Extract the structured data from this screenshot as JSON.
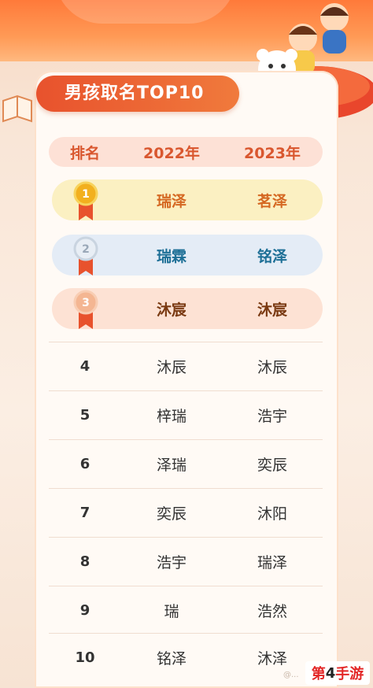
{
  "title": "男孩取名TOP10",
  "header": {
    "rank": "排名",
    "year_a": "2022年",
    "year_b": "2023年"
  },
  "medal_numbers": [
    "1",
    "2",
    "3"
  ],
  "rows": [
    {
      "rank": "1",
      "a": "瑞泽",
      "b": "茗泽"
    },
    {
      "rank": "2",
      "a": "瑞霖",
      "b": "铭泽"
    },
    {
      "rank": "3",
      "a": "沐宸",
      "b": "沐宸"
    },
    {
      "rank": "4",
      "a": "沐辰",
      "b": "沐辰"
    },
    {
      "rank": "5",
      "a": "梓瑞",
      "b": "浩宇"
    },
    {
      "rank": "6",
      "a": "泽瑞",
      "b": "奕辰"
    },
    {
      "rank": "7",
      "a": "奕辰",
      "b": "沐阳"
    },
    {
      "rank": "8",
      "a": "浩宇",
      "b": "瑞泽"
    },
    {
      "rank": "9",
      "a": "瑞",
      "b": "浩然"
    },
    {
      "rank": "10",
      "a": "铭泽",
      "b": "沐泽"
    }
  ],
  "watermark": "@...",
  "brand": {
    "part1": "第",
    "part2": "4",
    "part3": "手游"
  },
  "colors": {
    "gold": "#f2b01e",
    "silver": "#cfd9e6",
    "bronze": "#f1a67c",
    "ribbon": "#e8522d"
  }
}
